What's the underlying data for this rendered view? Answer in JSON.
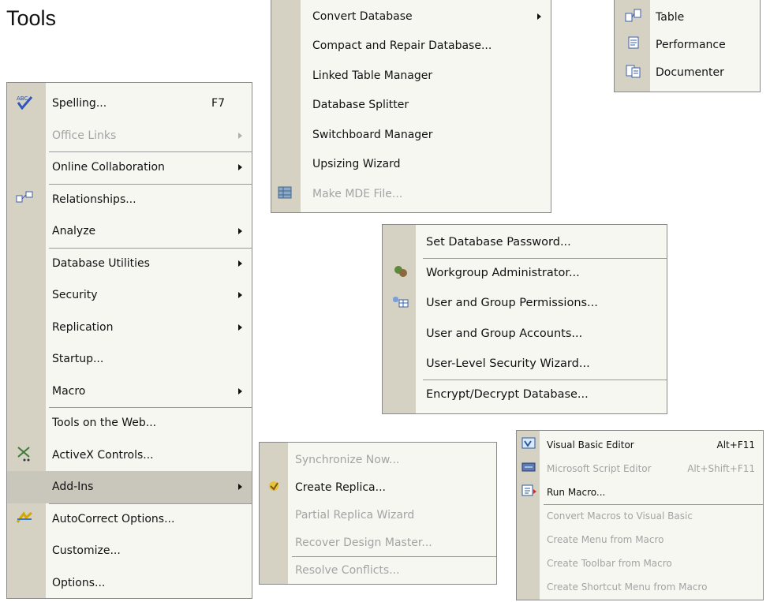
{
  "heading": "Tools",
  "tools_menu": [
    {
      "label": "Spelling...",
      "shortcut": "F7",
      "icon": "spelling-icon"
    },
    {
      "label": "Office Links",
      "disabled": true,
      "submenu": true
    },
    {
      "label": "Online Collaboration",
      "submenu": true
    },
    {
      "label": "Relationships...",
      "icon": "relationships-icon"
    },
    {
      "label": "Analyze",
      "submenu": true
    },
    {
      "label": "Database Utilities",
      "submenu": true
    },
    {
      "label": "Security",
      "submenu": true
    },
    {
      "label": "Replication",
      "submenu": true
    },
    {
      "label": "Startup..."
    },
    {
      "label": "Macro",
      "submenu": true
    },
    {
      "label": "Tools on the Web..."
    },
    {
      "label": "ActiveX Controls...",
      "icon": "activex-icon"
    },
    {
      "label": "Add-Ins",
      "submenu": true,
      "highlighted": true
    },
    {
      "label": "AutoCorrect Options...",
      "icon": "autocorrect-icon"
    },
    {
      "label": "Customize..."
    },
    {
      "label": "Options..."
    }
  ],
  "database_utilities_menu": [
    {
      "label": "Convert Database",
      "submenu": true
    },
    {
      "label": "Compact and Repair Database..."
    },
    {
      "label": "Linked Table Manager"
    },
    {
      "label": "Database Splitter"
    },
    {
      "label": "Switchboard Manager"
    },
    {
      "label": "Upsizing Wizard"
    },
    {
      "label": "Make MDE File...",
      "disabled": true,
      "icon": "make-mde-icon"
    }
  ],
  "analyze_menu": [
    {
      "label": "Table",
      "icon": "table-analyze-icon"
    },
    {
      "label": "Performance",
      "icon": "performance-icon"
    },
    {
      "label": "Documenter",
      "icon": "documenter-icon"
    }
  ],
  "security_menu": [
    {
      "label": "Set Database Password..."
    },
    {
      "label": "Workgroup Administrator...",
      "icon": "workgroup-icon"
    },
    {
      "label": "User and Group Permissions...",
      "icon": "permissions-icon"
    },
    {
      "label": "User and Group Accounts..."
    },
    {
      "label": "User-Level Security Wizard..."
    },
    {
      "label": "Encrypt/Decrypt Database..."
    }
  ],
  "replication_menu": [
    {
      "label": "Synchronize Now...",
      "disabled": true
    },
    {
      "label": "Create Replica...",
      "icon": "create-replica-icon"
    },
    {
      "label": "Partial Replica Wizard",
      "disabled": true
    },
    {
      "label": "Recover Design Master...",
      "disabled": true
    },
    {
      "label": "Resolve Conflicts...",
      "disabled": true
    }
  ],
  "macro_menu": [
    {
      "label": "Visual Basic Editor",
      "shortcut": "Alt+F11",
      "icon": "vb-editor-icon"
    },
    {
      "label": "Microsoft Script Editor",
      "shortcut": "Alt+Shift+F11",
      "disabled": true,
      "icon": "script-editor-icon"
    },
    {
      "label": "Run Macro...",
      "icon": "run-macro-icon"
    },
    {
      "label": "Convert Macros to Visual Basic",
      "disabled": true
    },
    {
      "label": "Create Menu from Macro",
      "disabled": true
    },
    {
      "label": "Create Toolbar from Macro",
      "disabled": true
    },
    {
      "label": "Create Shortcut Menu from Macro",
      "disabled": true
    }
  ]
}
